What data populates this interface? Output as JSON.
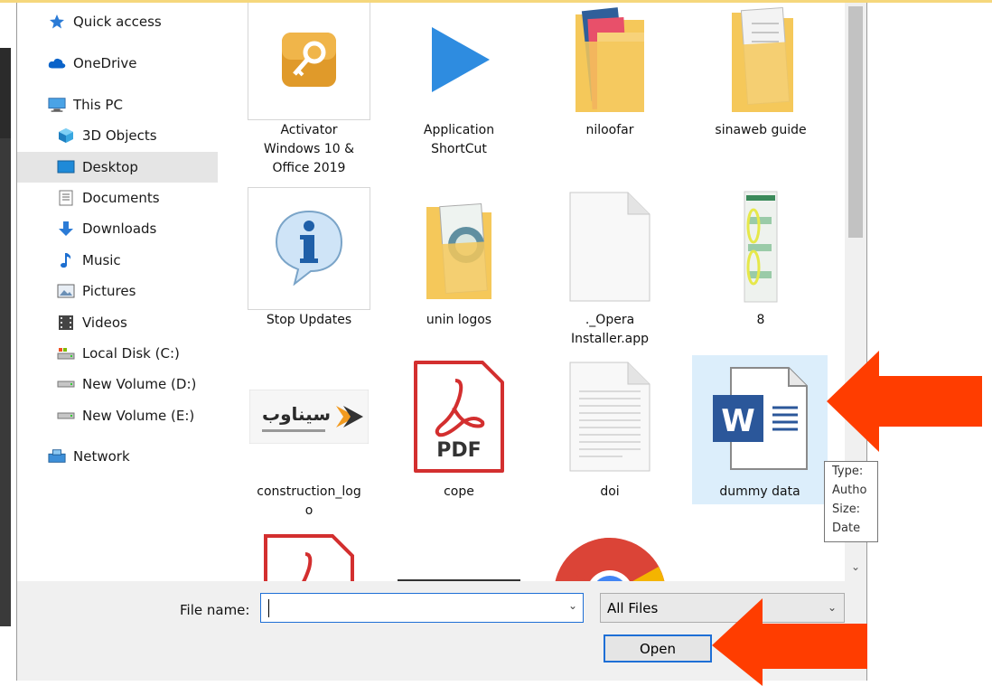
{
  "nav": {
    "items": [
      {
        "label": "Quick access",
        "icon": "star-icon"
      },
      {
        "label": "OneDrive",
        "icon": "cloud-icon"
      },
      {
        "label": "This PC",
        "icon": "computer-icon"
      },
      {
        "label": "3D Objects",
        "icon": "cube-icon"
      },
      {
        "label": "Desktop",
        "icon": "desktop-icon",
        "selected": true
      },
      {
        "label": "Documents",
        "icon": "document-icon"
      },
      {
        "label": "Downloads",
        "icon": "download-icon"
      },
      {
        "label": "Music",
        "icon": "music-icon"
      },
      {
        "label": "Pictures",
        "icon": "picture-icon"
      },
      {
        "label": "Videos",
        "icon": "video-icon"
      },
      {
        "label": "Local Disk (C:)",
        "icon": "drive-icon"
      },
      {
        "label": "New Volume (D:)",
        "icon": "drive-icon"
      },
      {
        "label": "New Volume (E:)",
        "icon": "drive-icon"
      },
      {
        "label": "Network",
        "icon": "network-icon"
      }
    ]
  },
  "files": [
    {
      "name": "Activator Windows 10 & Office 2019",
      "lines": [
        "Activator",
        "Windows 10 &",
        "Office 2019"
      ],
      "icon": "key-app-icon"
    },
    {
      "name": "Application ShortCut",
      "lines": [
        "Application",
        "ShortCut"
      ],
      "icon": "play-shortcut-icon"
    },
    {
      "name": "niloofar",
      "lines": [
        "niloofar"
      ],
      "icon": "folder-icon"
    },
    {
      "name": "sinaweb guide",
      "lines": [
        "sinaweb guide"
      ],
      "icon": "folder-icon"
    },
    {
      "name": "Stop Updates",
      "lines": [
        "Stop Updates"
      ],
      "icon": "info-icon"
    },
    {
      "name": "unin logos",
      "lines": [
        "unin logos"
      ],
      "icon": "folder-icon"
    },
    {
      "name": "._Opera Installer.app",
      "lines": [
        "._Opera",
        "Installer.app"
      ],
      "icon": "blank-file-icon"
    },
    {
      "name": "8",
      "lines": [
        "8"
      ],
      "icon": "image-file-icon"
    },
    {
      "name": "construction_logo",
      "lines": [
        "construction_log",
        "o"
      ],
      "icon": "logo-image-icon",
      "logo_text": "سیناوب"
    },
    {
      "name": "cope",
      "lines": [
        "cope"
      ],
      "icon": "pdf-icon",
      "badge": "PDF"
    },
    {
      "name": "doi",
      "lines": [
        "doi"
      ],
      "icon": "text-file-icon"
    },
    {
      "name": "dummy data",
      "lines": [
        "dummy data"
      ],
      "icon": "word-doc-icon",
      "badge": "W",
      "selected": true
    }
  ],
  "tooltip": {
    "lines": [
      "Type:",
      "Autho",
      "Size:",
      "Date"
    ]
  },
  "bottom": {
    "file_name_label": "File name:",
    "file_name_value": "",
    "filter_value": "All Files",
    "open_label": "Open"
  },
  "colors": {
    "accent": "#1e6fd6",
    "selection": "#dceefb",
    "arrow": "#ff3d00",
    "folder": "#f5c85a",
    "pdf": "#d32f2f",
    "word": "#2b579a"
  }
}
